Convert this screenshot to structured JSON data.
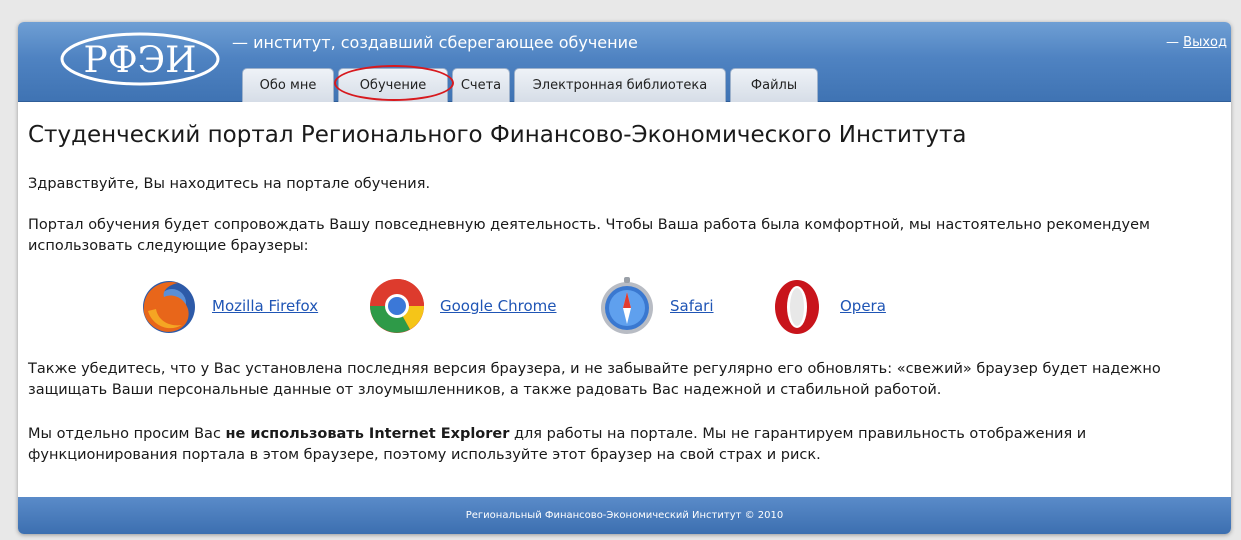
{
  "header": {
    "logo_text": "РФЭИ",
    "tagline": "— институт, создавший сберегающее обучение",
    "logout_prefix": "— ",
    "logout_label": "Выход"
  },
  "tabs": [
    {
      "label": "Обо мне"
    },
    {
      "label": "Обучение",
      "highlighted": true
    },
    {
      "label": "Счета"
    },
    {
      "label": "Электронная библиотека"
    },
    {
      "label": "Файлы"
    }
  ],
  "main": {
    "title": "Студенческий портал Регионального Финансово-Экономического Института",
    "greeting": "Здравствуйте, Вы находитесь на портале обучения.",
    "intro": "Портал обучения будет сопровождать Вашу повседневную деятельность. Чтобы Ваша работа была комфортной, мы настоятельно рекомендуем использовать следующие браузеры:",
    "browsers": [
      {
        "name": "Mozilla Firefox",
        "icon": "firefox-icon"
      },
      {
        "name": "Google Chrome",
        "icon": "chrome-icon"
      },
      {
        "name": "Safari",
        "icon": "safari-icon"
      },
      {
        "name": "Opera",
        "icon": "opera-icon"
      }
    ],
    "update_note": "Также убедитесь, что у Вас установлена последняя версия браузера, и не забывайте регулярно его обновлять: «свежий» браузер будет надежно защищать Ваши персональные данные от злоумышленников, а также радовать Вас надежной и стабильной работой.",
    "ie_warning_start": "Мы отдельно просим Вас ",
    "ie_warning_bold": "не использовать Internet Explorer",
    "ie_warning_end": " для работы на портале. Мы не гарантируем правильность отображения и функционирования портала в этом браузере, поэтому используйте этот браузер на свой страх и риск."
  },
  "footer": {
    "copyright": "Региональный Финансово-Экономический Институт © 2010"
  },
  "colors": {
    "header_blue": "#4f83c2",
    "link_blue": "#1f55b5",
    "highlight_red": "#d7191e"
  }
}
